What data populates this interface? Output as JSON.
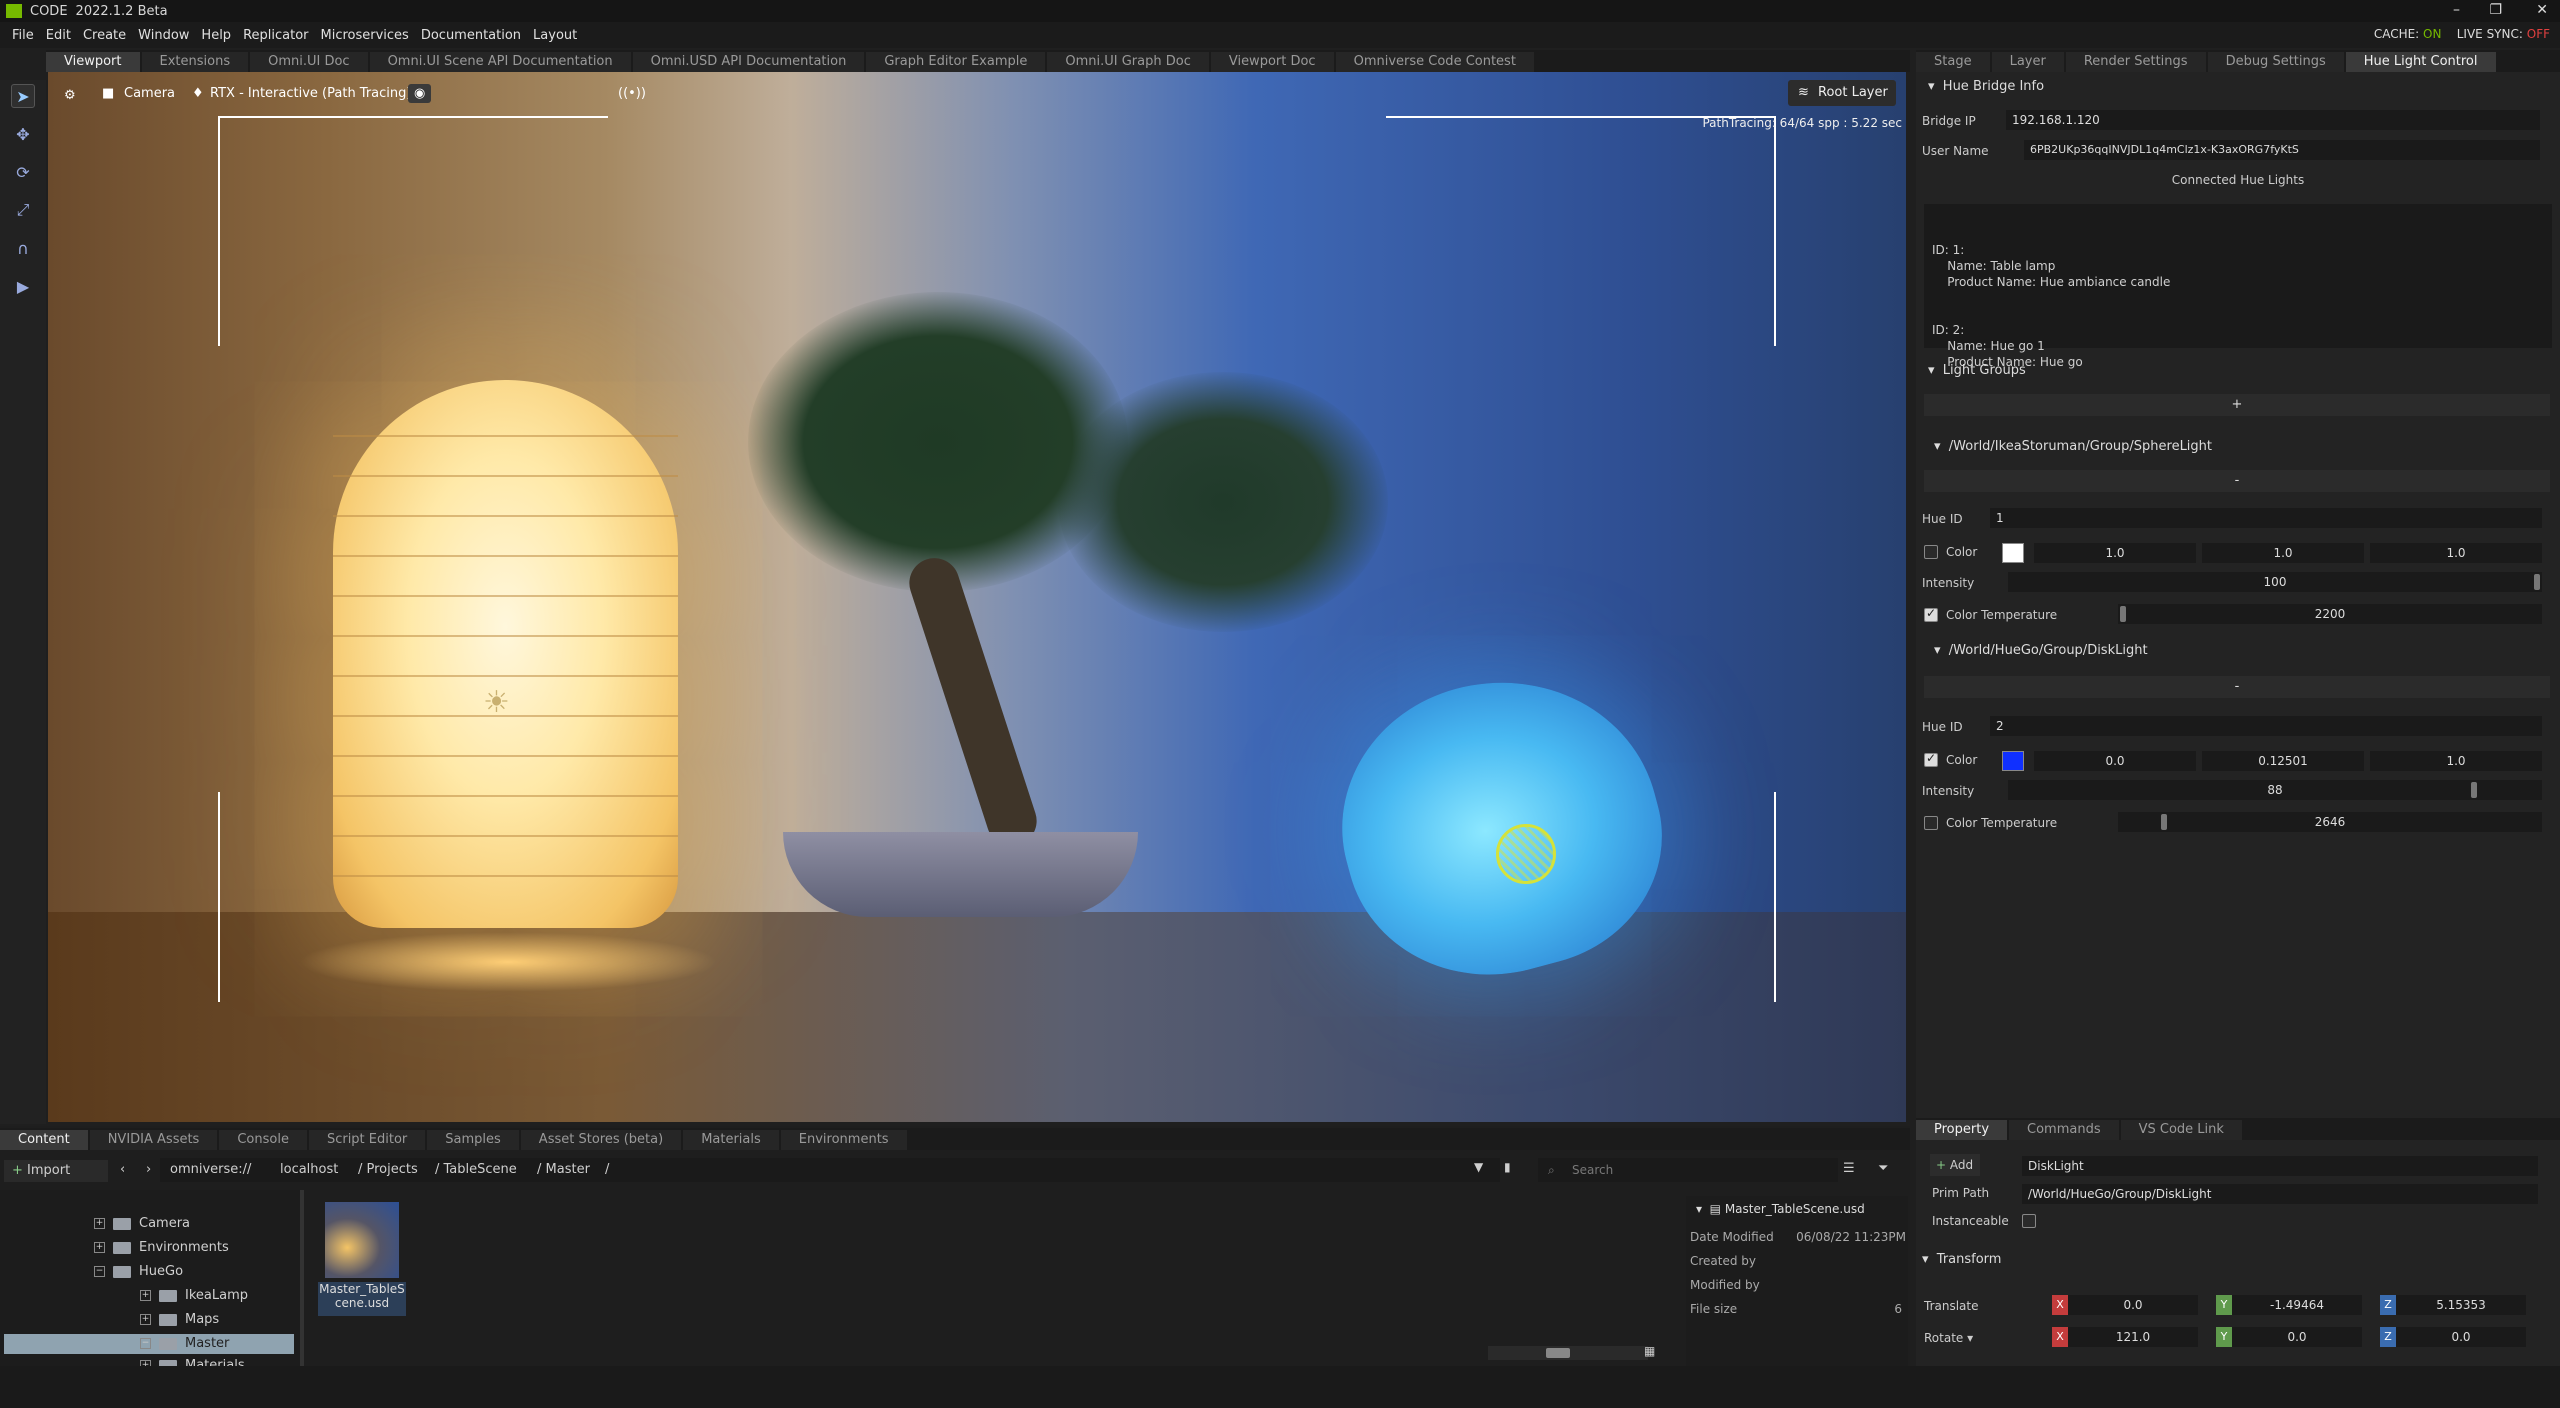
{
  "titlebar": {
    "app": "CODE",
    "version": "2022.1.2 Beta"
  },
  "menu": [
    "File",
    "Edit",
    "Create",
    "Window",
    "Help",
    "Replicator",
    "Microservices",
    "Documentation",
    "Layout"
  ],
  "status": {
    "cache_label": "CACHE:",
    "cache_value": "ON",
    "livesync_label": "LIVE SYNC:",
    "livesync_value": "OFF"
  },
  "top_tabs": [
    "Viewport",
    "Extensions",
    "Omni.UI Doc",
    "Omni.UI Scene API Documentation",
    "Omni.USD API Documentation",
    "Graph Editor Example",
    "Omni.UI Graph Doc",
    "Viewport Doc",
    "Omniverse Code Contest"
  ],
  "right_tabs": [
    "Stage",
    "Layer",
    "Render Settings",
    "Debug Settings",
    "Hue Light Control"
  ],
  "viewport": {
    "camera": "Camera",
    "renderer": "RTX - Interactive (Path Tracing)",
    "root_layer": "Root Layer",
    "pathtracing": "PathTracing: 64/64 spp : 5.22 sec"
  },
  "hue": {
    "bridge_info_title": "Hue Bridge Info",
    "bridge_ip_label": "Bridge IP",
    "bridge_ip": "192.168.1.120",
    "user_name_label": "User Name",
    "user_name": "6PB2UKp36qqINVJDL1q4mClz1x-K3axORG7fyKtS",
    "connected_title": "Connected Hue Lights",
    "connected_lines": [
      "ID: 1:",
      "    Name: Table lamp",
      "    Product Name: Hue ambiance candle",
      "ID: 2:",
      "    Name: Hue go 1",
      "    Product Name: Hue go"
    ],
    "groups_title": "Light Groups",
    "add_label": "+",
    "remove_label": "-",
    "group1": {
      "path": "/World/IkeaStoruman/Group/SphereLight",
      "hue_id_label": "Hue ID",
      "hue_id": "1",
      "color_label": "Color",
      "color_hex": "#ffffff",
      "color": [
        "1.0",
        "1.0",
        "1.0"
      ],
      "intensity_label": "Intensity",
      "intensity": "100",
      "intensity_fraction": 1.0,
      "temp_label": "Color Temperature",
      "temp": "2200",
      "temp_fraction": 0.0,
      "color_checked": false,
      "temp_checked": true
    },
    "group2": {
      "path": "/World/HueGo/Group/DiskLight",
      "hue_id_label": "Hue ID",
      "hue_id": "2",
      "color_label": "Color",
      "color_hex": "#1030ff",
      "color": [
        "0.0",
        "0.12501",
        "1.0"
      ],
      "intensity_label": "Intensity",
      "intensity": "88",
      "intensity_fraction": 0.88,
      "temp_label": "Color Temperature",
      "temp": "2646",
      "temp_fraction": 0.1,
      "color_checked": true,
      "temp_checked": false
    }
  },
  "content_tabs": [
    "Content",
    "NVIDIA Assets",
    "Console",
    "Script Editor",
    "Samples",
    "Asset Stores (beta)",
    "Materials",
    "Environments"
  ],
  "content": {
    "import": "Import",
    "path": [
      "omniverse://",
      "localhost",
      "/ Projects",
      "/ TableScene",
      "/ Master",
      "/"
    ],
    "search": "Search",
    "tree": [
      "Camera",
      "Environments",
      "HueGo",
      "IkeaLamp",
      "Maps",
      "Master",
      "Materials"
    ],
    "thumb_label": "Master_TableScene.usd",
    "details_title": "Master_TableScene.usd",
    "details": [
      {
        "k": "Date Modified",
        "v": "06/08/22 11:23PM"
      },
      {
        "k": "Created by",
        "v": ""
      },
      {
        "k": "Modified by",
        "v": ""
      },
      {
        "k": "File size",
        "v": "6"
      }
    ]
  },
  "prop_tabs": [
    "Property",
    "Commands",
    "VS Code Link"
  ],
  "property": {
    "add": "Add",
    "name": "DiskLight",
    "prim_path_label": "Prim Path",
    "prim_path": "/World/HueGo/Group/DiskLight",
    "instanceable_label": "Instanceable",
    "transform": "Transform",
    "translate_label": "Translate",
    "translate": [
      "0.0",
      "-1.49464",
      "5.15353"
    ],
    "rotate_label": "Rotate ▾",
    "rotate": [
      "121.0",
      "0.0",
      "0.0"
    ]
  }
}
